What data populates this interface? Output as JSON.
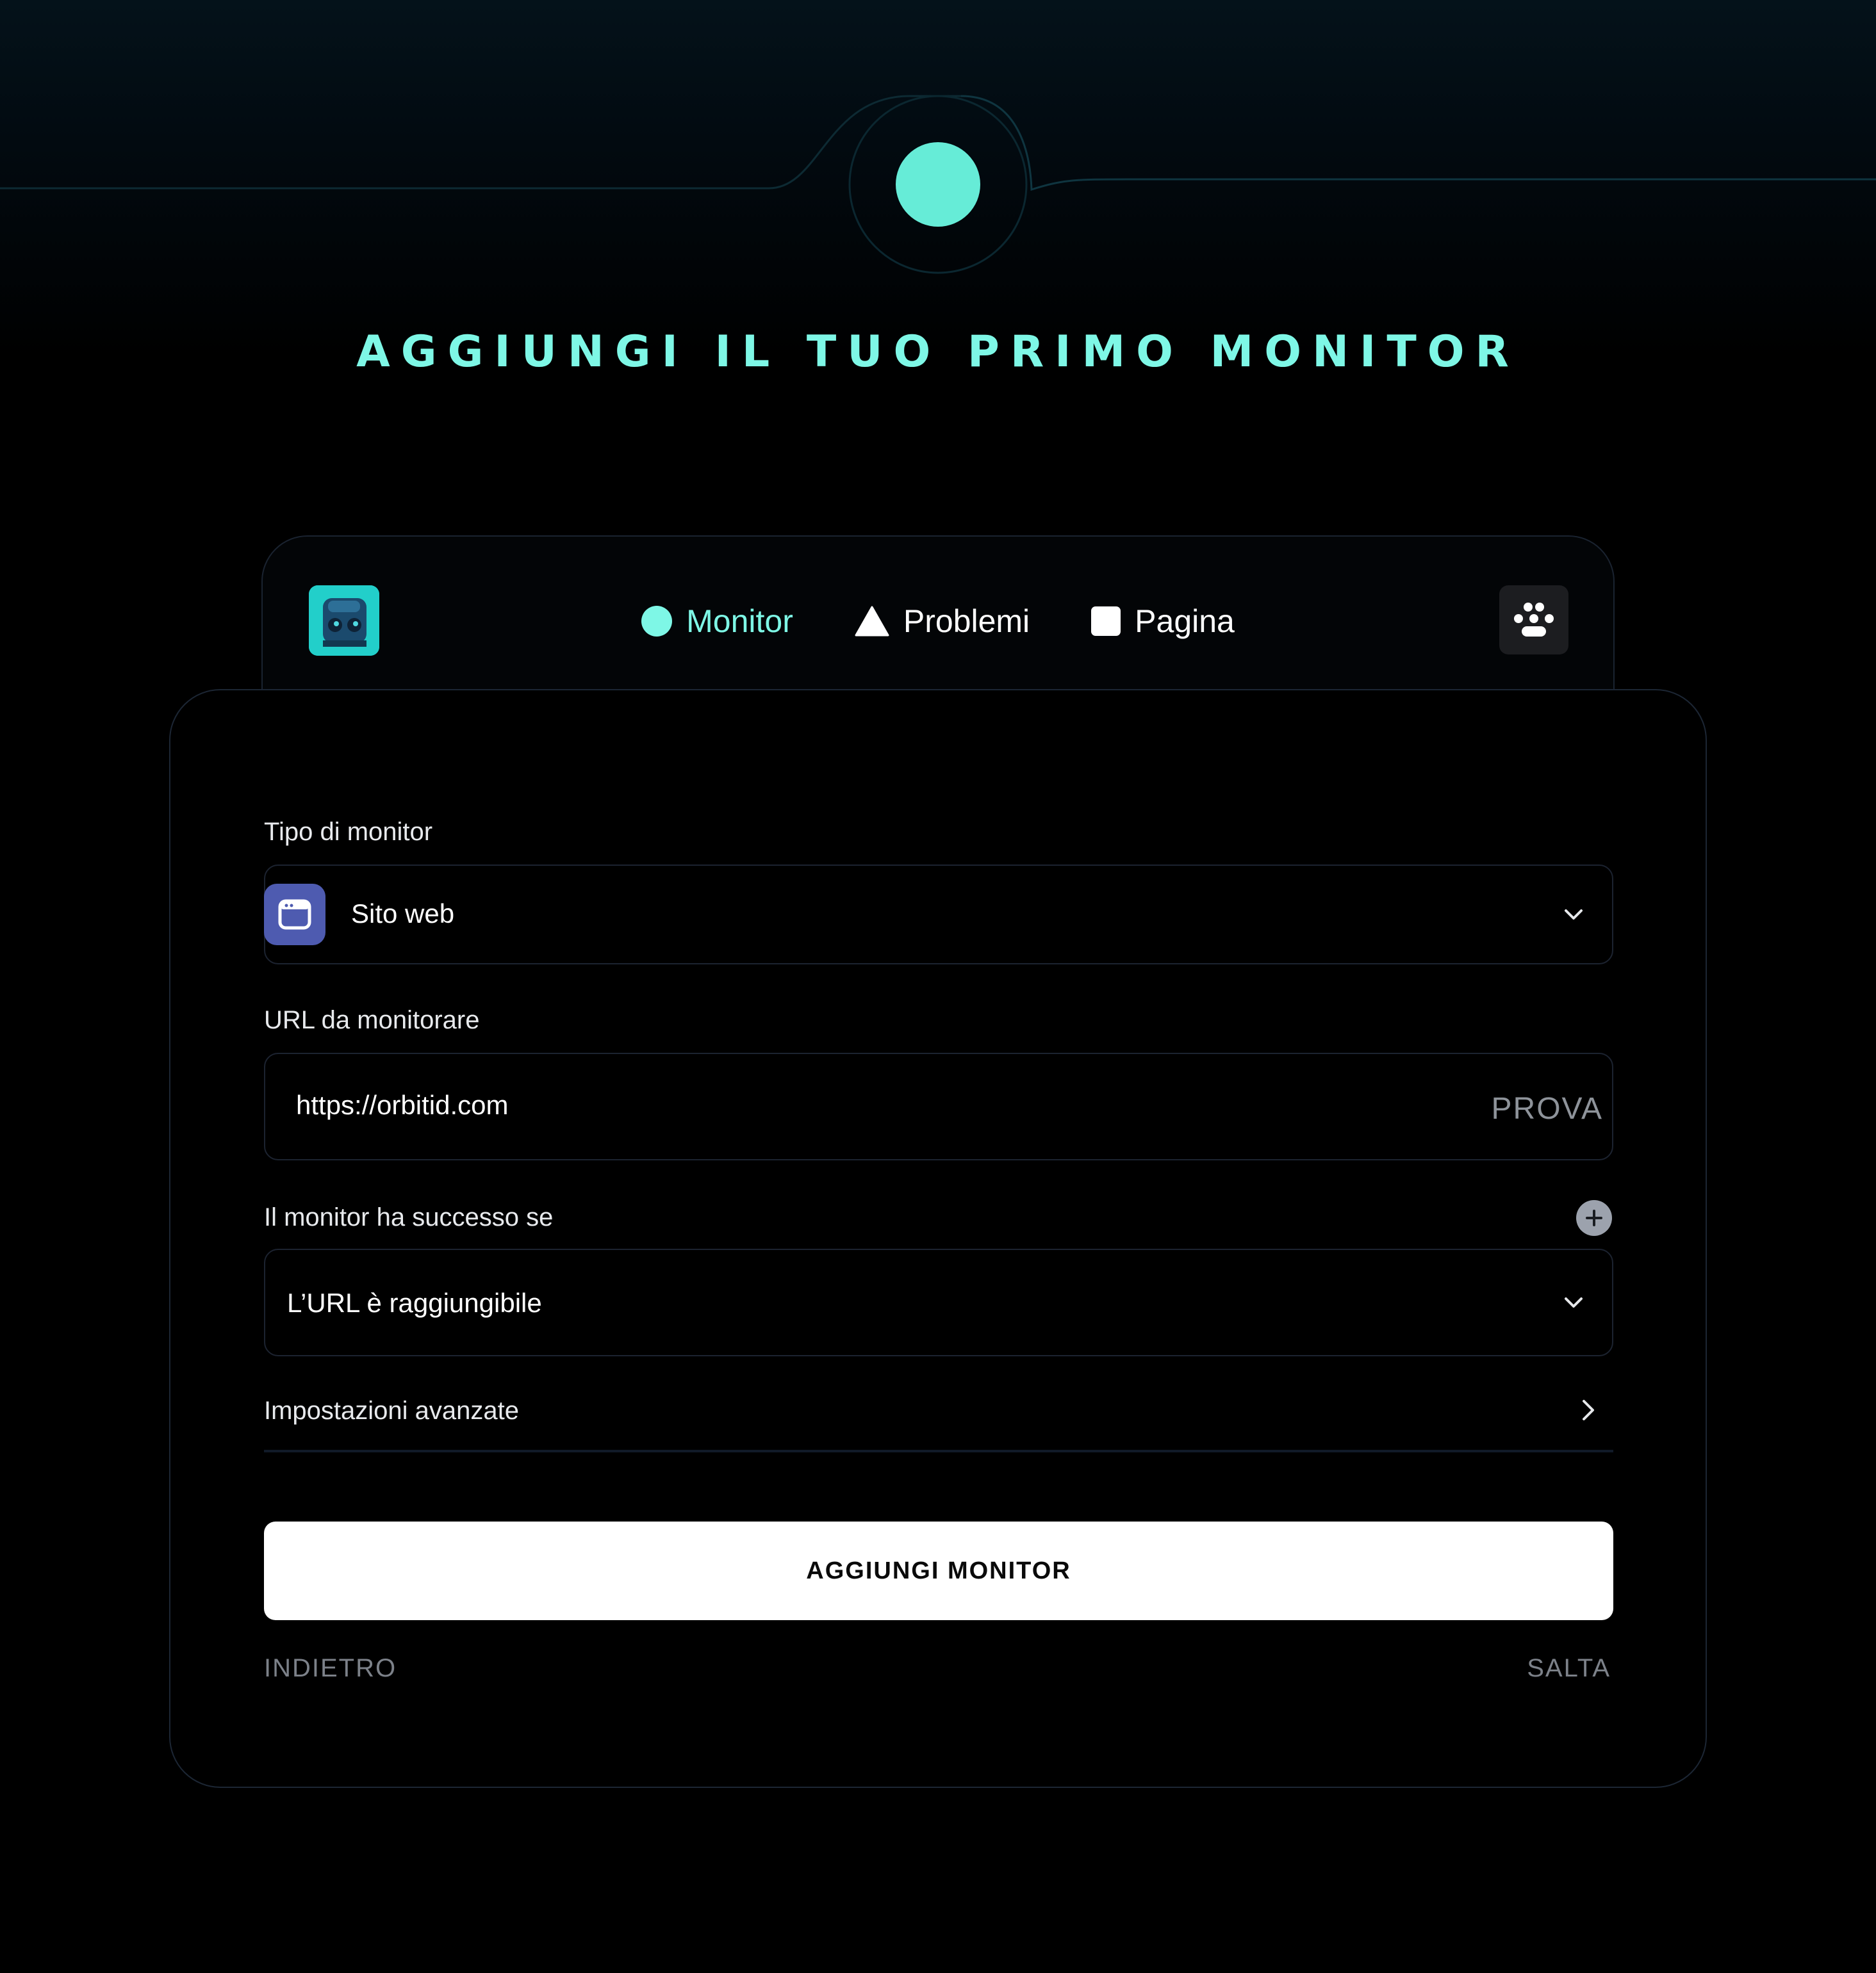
{
  "page": {
    "title": "AGGIUNGI IL TUO PRIMO MONITOR"
  },
  "nav": {
    "items": [
      {
        "label": "Monitor",
        "icon": "dot-icon",
        "active": true
      },
      {
        "label": "Problemi",
        "icon": "triangle-icon",
        "active": false
      },
      {
        "label": "Pagina",
        "icon": "square-icon",
        "active": false
      }
    ]
  },
  "form": {
    "type_label": "Tipo di monitor",
    "type_value": "Sito web",
    "url_label": "URL da monitorare",
    "url_value": "https://orbitid.com",
    "test_label": "PROVA",
    "success_label": "Il monitor ha successo se",
    "success_value": "L’URL è raggiungibile",
    "advanced_label": "Impostazioni avanzate",
    "submit_label": "AGGIUNGI MONITOR",
    "back_label": "INDIETRO",
    "skip_label": "SALTA"
  },
  "colors": {
    "accent": "#7ef7e6",
    "background": "#000000",
    "type_icon_bg": "#4e5bb0",
    "muted_text": "#7c8189"
  }
}
